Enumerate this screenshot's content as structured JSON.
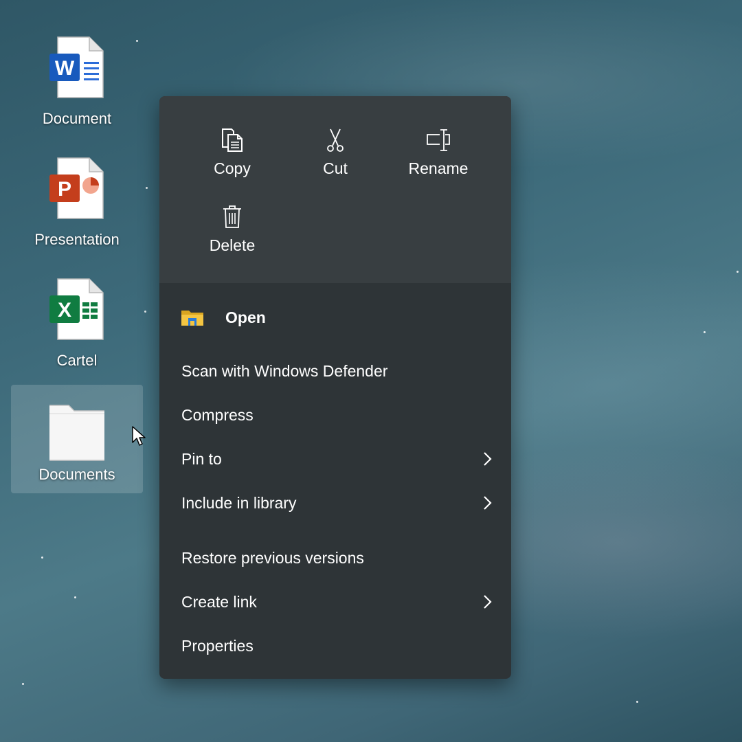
{
  "desktop": {
    "icons": [
      {
        "label": "Document",
        "type": "word",
        "glyph": "W"
      },
      {
        "label": "Presentation",
        "type": "powerpoint",
        "glyph": "P"
      },
      {
        "label": "Cartel",
        "type": "excel",
        "glyph": "X"
      },
      {
        "label": "Documents",
        "type": "folder",
        "selected": true
      }
    ]
  },
  "context_menu": {
    "quick_actions": [
      {
        "label": "Copy",
        "icon": "copy-icon"
      },
      {
        "label": "Cut",
        "icon": "scissors-icon"
      },
      {
        "label": "Rename",
        "icon": "rename-icon"
      },
      {
        "label": "Delete",
        "icon": "trash-icon"
      }
    ],
    "items": [
      {
        "label": "Open",
        "icon": "file-explorer-icon",
        "bold": true
      },
      {
        "label": "Scan with Windows Defender"
      },
      {
        "label": "Compress"
      },
      {
        "label": "Pin to",
        "submenu": true
      },
      {
        "label": "Include in library",
        "submenu": true
      },
      {
        "label": "Restore previous versions"
      },
      {
        "label": "Create link",
        "submenu": true
      },
      {
        "label": "Properties"
      }
    ]
  },
  "colors": {
    "menu_background": "#2e3437",
    "quick_actions_background": "#383e41",
    "word_blue": "#185abd",
    "powerpoint_orange": "#c43e1c",
    "excel_green": "#107c41",
    "folder_yellow": "#f4c542"
  }
}
